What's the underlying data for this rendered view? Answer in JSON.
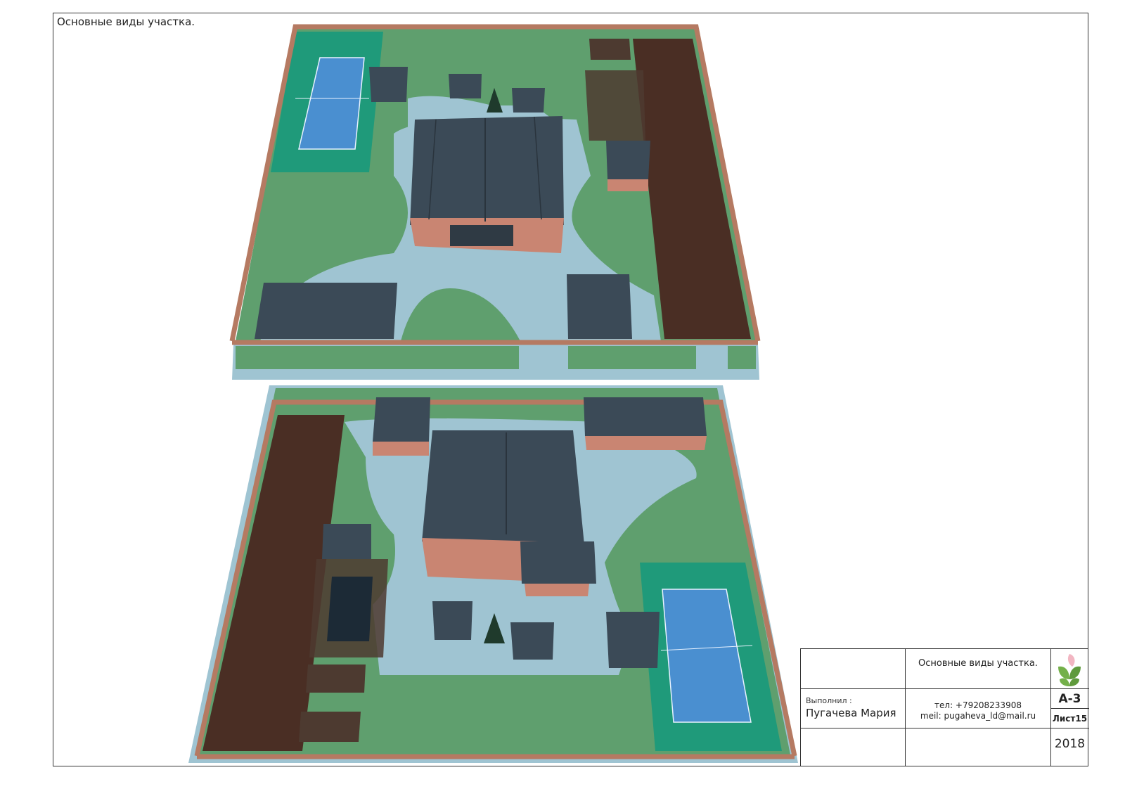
{
  "sheet": {
    "title": "Основные виды участка."
  },
  "stamp": {
    "sheet_name": "Основные виды участка.",
    "done_by_label": "Выполнил :",
    "author": "Пугачева Мария",
    "phone": "тел: +79208233908",
    "email": "meil: pugaheva_ld@mail.ru",
    "format": "А-3",
    "sheet_number": "Лист15",
    "year": "2018",
    "logo_icon": "leaf-logo-icon"
  },
  "colors": {
    "lawn": "#5f9f6e",
    "paving": "#9fc4d2",
    "roof": "#3b4a57",
    "brick": "#c98572",
    "fence": "#b57a62",
    "soil": "#4a2e24",
    "court_outer": "#1f9a7a",
    "court_inner": "#4a8fd0"
  }
}
